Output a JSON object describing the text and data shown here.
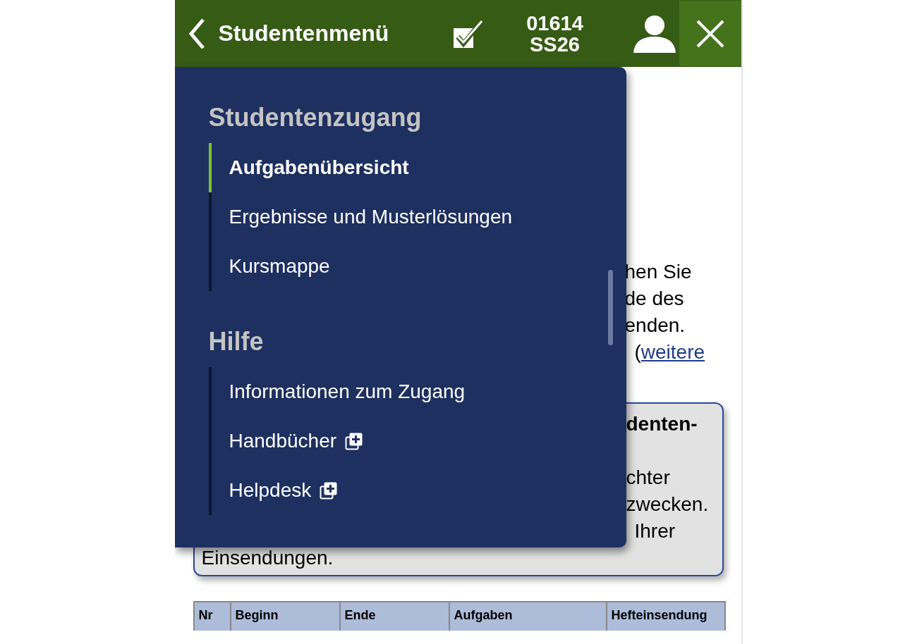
{
  "header": {
    "back_label": "Studentenmenü",
    "course_number": "01614",
    "semester": "SS26"
  },
  "menu": {
    "sections": [
      {
        "heading": "Studentenzugang",
        "items": [
          {
            "label": "Aufgabenübersicht",
            "selected": true,
            "new_window": false
          },
          {
            "label": "Ergebnisse und Musterlösungen",
            "selected": false,
            "new_window": false
          },
          {
            "label": "Kursmappe",
            "selected": false,
            "new_window": false
          }
        ]
      },
      {
        "heading": "Hilfe",
        "items": [
          {
            "label": "Informationen zum Zugang",
            "selected": false,
            "new_window": false
          },
          {
            "label": "Handbücher",
            "selected": false,
            "new_window": true
          },
          {
            "label": "Helpdesk",
            "selected": false,
            "new_window": true
          }
        ]
      }
    ]
  },
  "intro_fragments": [
    {
      "text": "hen Sie"
    },
    {
      "text": "de des"
    },
    {
      "text": "enden."
    },
    {
      "text": "(",
      "link": "weitere"
    }
  ],
  "notice_lines": [
    {
      "kind": "cut",
      "text": "denten-",
      "bold": true
    },
    {
      "kind": "blank"
    },
    {
      "kind": "cut",
      "text": "chter",
      "bold": false
    },
    {
      "kind": "cut",
      "text": "zwecken.",
      "bold": false
    },
    {
      "kind": "cut",
      "text": "Ihrer",
      "bold": false
    },
    {
      "kind": "full",
      "text": "Einsendungen.",
      "bold": false
    }
  ],
  "table": {
    "columns": [
      "Nr",
      "Beginn",
      "Ende",
      "Aufgaben",
      "Hefteinsendung"
    ]
  }
}
